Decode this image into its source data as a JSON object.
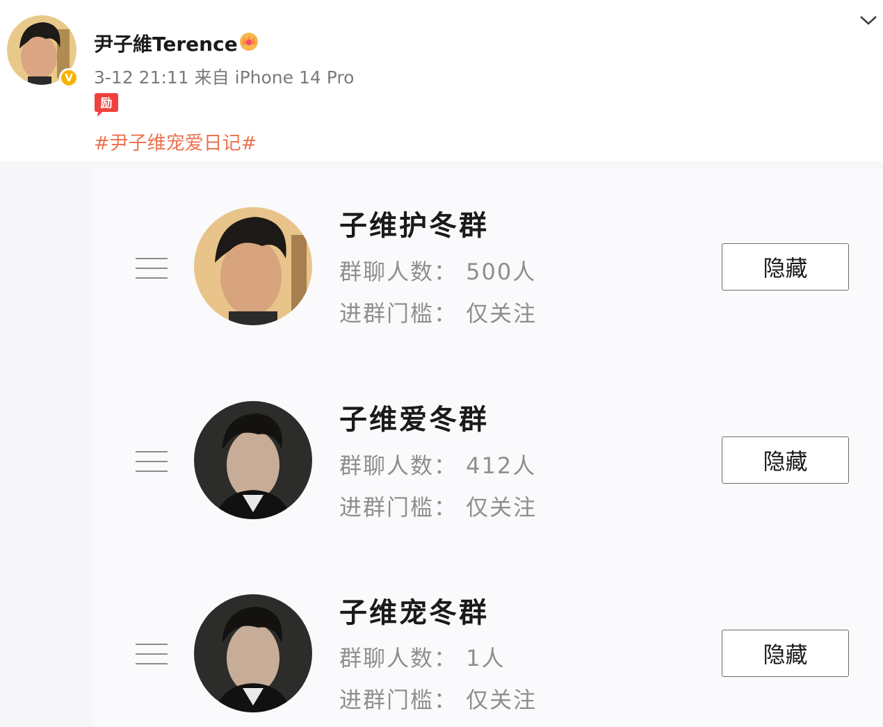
{
  "post": {
    "username": "尹子維Terence",
    "meta": "3-12 21:11  来自 iPhone 14 Pro",
    "hashtag": "#尹子维宠爱日记#"
  },
  "groups": [
    {
      "name": "子维护冬群",
      "count": "群聊人数：  500人",
      "threshold": "进群门槛：  仅关注",
      "button": "隐藏"
    },
    {
      "name": "子维爱冬群",
      "count": "群聊人数：  412人",
      "threshold": "进群门槛：  仅关注",
      "button": "隐藏"
    },
    {
      "name": "子维宠冬群",
      "count": "群聊人数：  1人",
      "threshold": "进群门槛：  仅关注",
      "button": "隐藏"
    }
  ],
  "icons": {
    "avatar": "user-avatar",
    "verified": "verified-v-badge",
    "crown": "crown-member-icon",
    "tag": "encourage-badge-icon",
    "collapse": "chevron-down-icon",
    "handle": "drag-handle-icon"
  },
  "colors": {
    "hashtag": "#eb7350",
    "verified": "#f5b400",
    "secondary_text": "#8e8e8e"
  }
}
